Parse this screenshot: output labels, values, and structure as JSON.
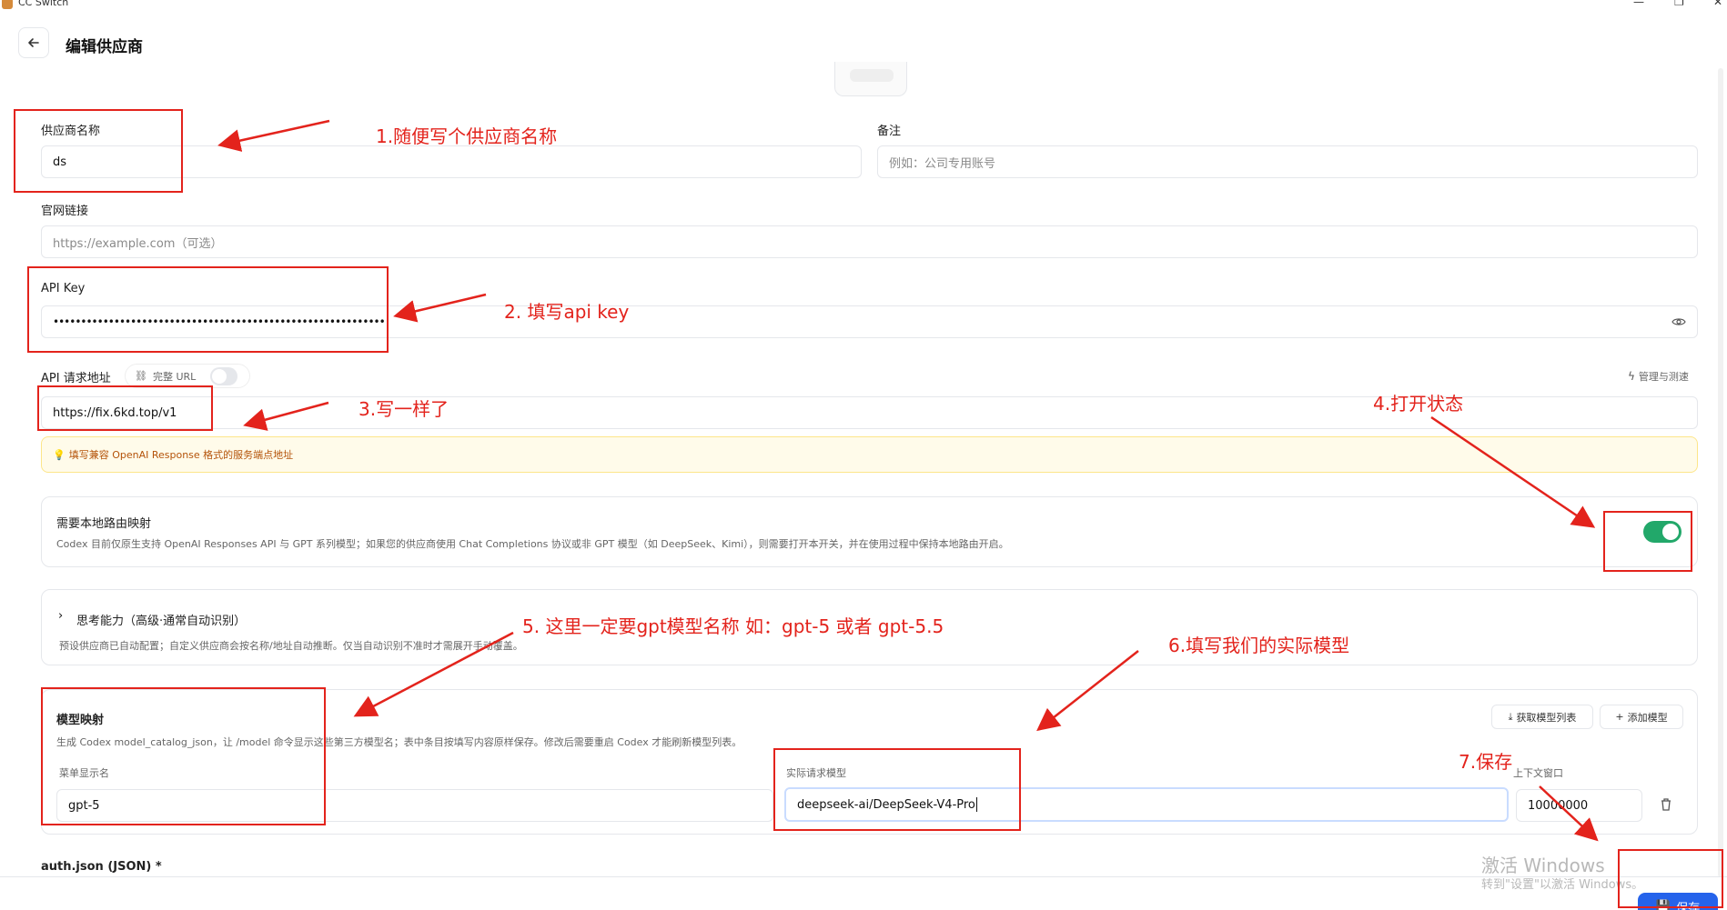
{
  "window": {
    "title": "CC Switch",
    "minimize_icon": "minimize-icon",
    "maximize_icon": "restore-icon",
    "close_icon": "close-icon"
  },
  "header": {
    "title": "编辑供应商",
    "back_icon": "arrow-left-icon"
  },
  "form": {
    "provider_name": {
      "label": "供应商名称",
      "value": "ds"
    },
    "notes": {
      "label": "备注",
      "placeholder": "例如：公司专用账号"
    },
    "website": {
      "label": "官网链接",
      "placeholder": "https://example.com（可选）"
    },
    "api_key": {
      "label": "API Key",
      "masked_value": "••••••••••••••••••••••••••••••••••••••••••••••••••••••••••••"
    },
    "api_url": {
      "label": "API 请求地址",
      "full_url_label": "完整 URL",
      "full_url_enabled": false,
      "manage_label": "管理与测速",
      "value": "https://fix.6kd.top/v1",
      "hint": "填写兼容 OpenAI Response 格式的服务端点地址"
    },
    "local_routing": {
      "title": "需要本地路由映射",
      "description": "Codex 目前仅原生支持 OpenAI Responses API 与 GPT 系列模型；如果您的供应商使用 Chat Completions 协议或非 GPT 模型（如 DeepSeek、Kimi），则需要打开本开关，并在使用过程中保持本地路由开启。",
      "enabled": true
    },
    "thinking": {
      "title": "思考能力（高级·通常自动识别）",
      "description": "预设供应商已自动配置；自定义供应商会按名称/地址自动推断。仅当自动识别不准时才需展开手动覆盖。"
    },
    "model_mapping": {
      "title": "模型映射",
      "description": "生成 Codex model_catalog_json，让 /model 命令显示这些第三方模型名；表中条目按填写内容原样保存。修改后需要重启 Codex 才能刷新模型列表。",
      "fetch_label": "获取模型列表",
      "add_label": "添加模型",
      "col_display": "菜单显示名",
      "col_actual": "实际请求模型",
      "col_context": "上下文窗口",
      "rows": [
        {
          "display": "gpt-5",
          "actual": "deepseek-ai/DeepSeek-V4-Pro",
          "context": "10000000"
        }
      ]
    },
    "auth_json_label": "auth.json (JSON) *",
    "save_label": "保存"
  },
  "annotations": {
    "a1": "1.随便写个供应商名称",
    "a2": "2. 填写api key",
    "a3": "3.写一样了",
    "a4": "4.打开状态",
    "a5": "5. 这里一定要gpt模型名称 如：gpt-5 或者 gpt-5.5",
    "a6": "6.填写我们的实际模型",
    "a7": "7.保存"
  },
  "watermark": {
    "line1": "激活 Windows",
    "line2": "转到\"设置\"以激活 Windows。"
  },
  "colors": {
    "annotation": "#e3231c",
    "toggle_on": "#22a86a",
    "save_button": "#2563eb"
  }
}
